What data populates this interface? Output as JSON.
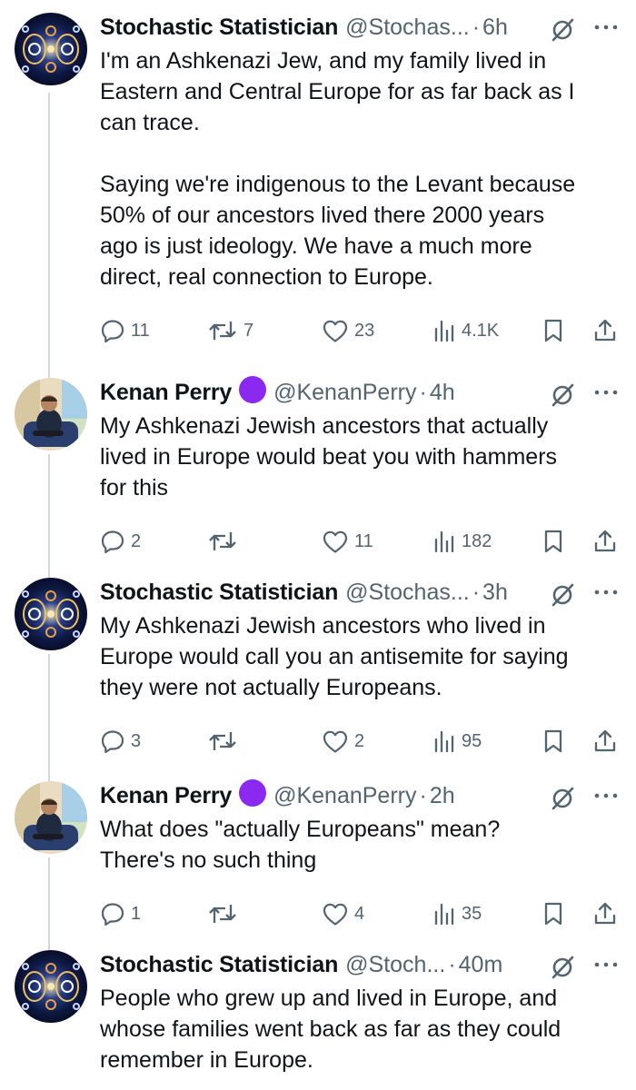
{
  "tweets": [
    {
      "name": "Stochastic Statistician",
      "handle": "@Stochas...",
      "time": "6h",
      "verified_badge": false,
      "avatar": "fractal-avatar",
      "text": "I'm an Ashkenazi Jew, and my family lived in\nEastern and Central Europe for as far back as I\ncan trace.\n\nSaying we're indigenous to the Levant because\n50% of our ancestors lived there 2000 years\nago is just ideology. We have a much more\ndirect, real connection to Europe.",
      "replies": "11",
      "reposts": "7",
      "likes": "23",
      "views": "4.1K"
    },
    {
      "name": "Kenan Perry",
      "handle": "@KenanPerry",
      "time": "4h",
      "verified_badge": true,
      "avatar": "person-avatar",
      "text": "My Ashkenazi Jewish ancestors that actually\nlived in Europe would beat you with hammers\nfor this",
      "replies": "2",
      "reposts": "",
      "likes": "11",
      "views": "182"
    },
    {
      "name": "Stochastic Statistician",
      "handle": "@Stochas...",
      "time": "3h",
      "verified_badge": false,
      "avatar": "fractal-avatar",
      "text": "My Ashkenazi Jewish ancestors who lived in\nEurope would call you an antisemite for saying\nthey were not actually Europeans.",
      "replies": "3",
      "reposts": "",
      "likes": "2",
      "views": "95"
    },
    {
      "name": "Kenan Perry",
      "handle": "@KenanPerry",
      "time": "2h",
      "verified_badge": true,
      "avatar": "person-avatar",
      "text": "What does \"actually Europeans\" mean?\nThere's no such thing",
      "replies": "1",
      "reposts": "",
      "likes": "4",
      "views": "35"
    },
    {
      "name": "Stochastic Statistician",
      "handle": "@Stoch...",
      "time": "40m",
      "verified_badge": false,
      "avatar": "fractal-avatar",
      "text": "People who grew up and lived in Europe, and\nwhose families went back as far as they could\nremember in Europe.",
      "replies": "",
      "reposts": "",
      "likes": "",
      "views": ""
    }
  ],
  "separator": "·",
  "colors": {
    "text": "#0f1419",
    "secondary": "#536471",
    "thread_line": "#cfd9de",
    "badge": "#8b29f0"
  },
  "icons": [
    "reply-icon",
    "repost-icon",
    "like-icon",
    "views-icon",
    "bookmark-icon",
    "share-icon",
    "grok-icon",
    "more-icon"
  ]
}
